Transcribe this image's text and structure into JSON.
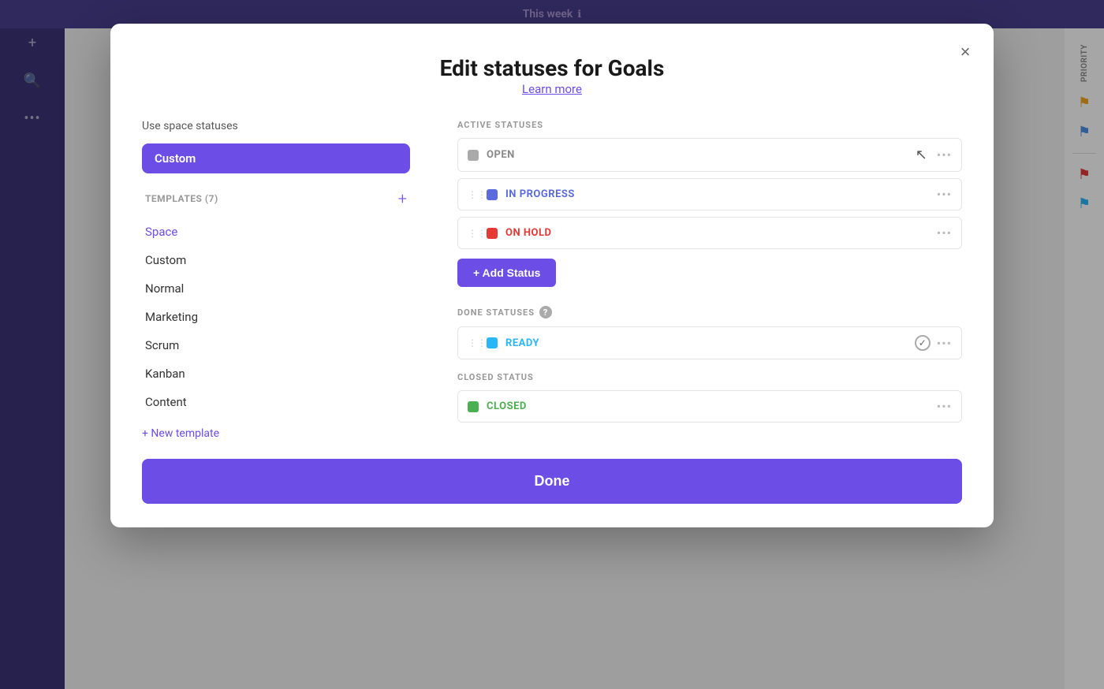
{
  "topBar": {
    "title": "This week",
    "infoIcon": "ℹ"
  },
  "modal": {
    "title": "Edit statuses for Goals",
    "learnMoreLabel": "Learn more",
    "closeIcon": "×",
    "leftPanel": {
      "useSpaceLabel": "Use space statuses",
      "customSelected": "Custom",
      "templatesHeader": "TEMPLATES (7)",
      "addTemplateIcon": "+",
      "templates": [
        {
          "label": "Space",
          "active": true
        },
        {
          "label": "Custom"
        },
        {
          "label": "Normal"
        },
        {
          "label": "Marketing"
        },
        {
          "label": "Scrum"
        },
        {
          "label": "Kanban"
        },
        {
          "label": "Content"
        }
      ],
      "newTemplateLabel": "+ New template"
    },
    "rightPanel": {
      "activeSectionLabel": "ACTIVE STATUSES",
      "activeStatuses": [
        {
          "name": "OPEN",
          "colorClass": "gray",
          "nameClass": "open"
        },
        {
          "name": "IN PROGRESS",
          "colorClass": "blue",
          "nameClass": "in-progress"
        },
        {
          "name": "ON HOLD",
          "colorClass": "red",
          "nameClass": "on-hold"
        }
      ],
      "addStatusLabel": "+ Add Status",
      "doneSectionLabel": "DONE STATUSES",
      "doneStatuses": [
        {
          "name": "READY",
          "colorClass": "cyan",
          "nameClass": "ready",
          "hasCheck": true
        }
      ],
      "closedSectionLabel": "CLOSED STATUS",
      "closedStatuses": [
        {
          "name": "CLOSED",
          "colorClass": "green",
          "nameClass": "closed"
        }
      ]
    },
    "doneButtonLabel": "Done"
  }
}
